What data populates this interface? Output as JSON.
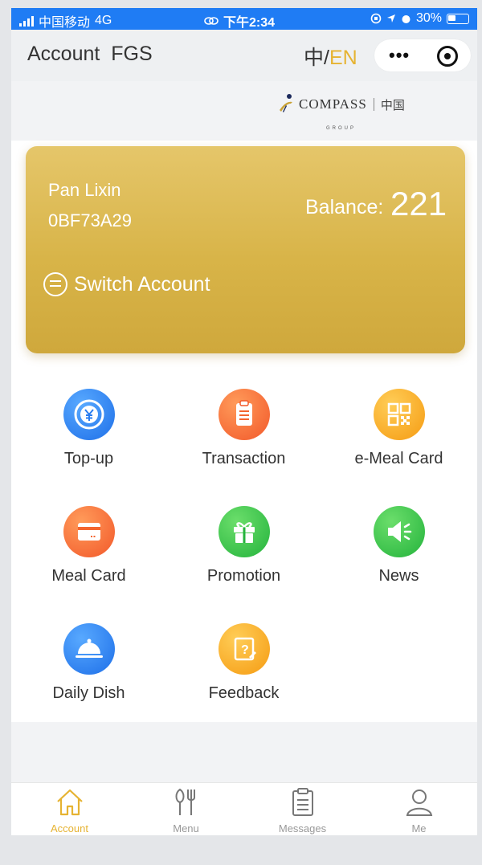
{
  "status_bar": {
    "carrier": "中国移动",
    "network": "4G",
    "time": "下午2:34",
    "battery": "30%"
  },
  "nav": {
    "title": "Account  FGS",
    "lang_cn": "中",
    "lang_sep": "/",
    "lang_en": "EN"
  },
  "logo": {
    "wordmark": "COMPASS",
    "sub": "GROUP",
    "cn": "中国"
  },
  "card": {
    "name": "Pan Lixin",
    "account_id": "0BF73A29",
    "balance_label": "Balance:",
    "balance_value": "221",
    "switch_label": "Switch Account"
  },
  "services": [
    {
      "label": "Top-up",
      "icon": "yen-coin-icon",
      "color": "#2a7df0"
    },
    {
      "label": "Transaction",
      "icon": "clipboard-icon",
      "color": "#f4662f"
    },
    {
      "label": "e-Meal Card",
      "icon": "qr-code-icon",
      "color": "#f7a51e"
    },
    {
      "label": "Meal Card",
      "icon": "card-icon",
      "color": "#f4662f"
    },
    {
      "label": "Promotion",
      "icon": "gift-icon",
      "color": "#2fbf45"
    },
    {
      "label": "News",
      "icon": "megaphone-icon",
      "color": "#2fbf45"
    },
    {
      "label": "Daily Dish",
      "icon": "cloche-icon",
      "color": "#2a7df0"
    },
    {
      "label": "Feedback",
      "icon": "question-note-icon",
      "color": "#f7a51e"
    }
  ],
  "tabbar": [
    {
      "label": "Account",
      "icon": "home-icon",
      "active": true
    },
    {
      "label": "Menu",
      "icon": "fork-knife-icon",
      "active": false
    },
    {
      "label": "Messages",
      "icon": "clipboard-list-icon",
      "active": false
    },
    {
      "label": "Me",
      "icon": "person-icon",
      "active": false
    }
  ],
  "colors": {
    "status_bar": "#1f7cf4",
    "accent": "#e6b332",
    "card": "#d8b448"
  }
}
